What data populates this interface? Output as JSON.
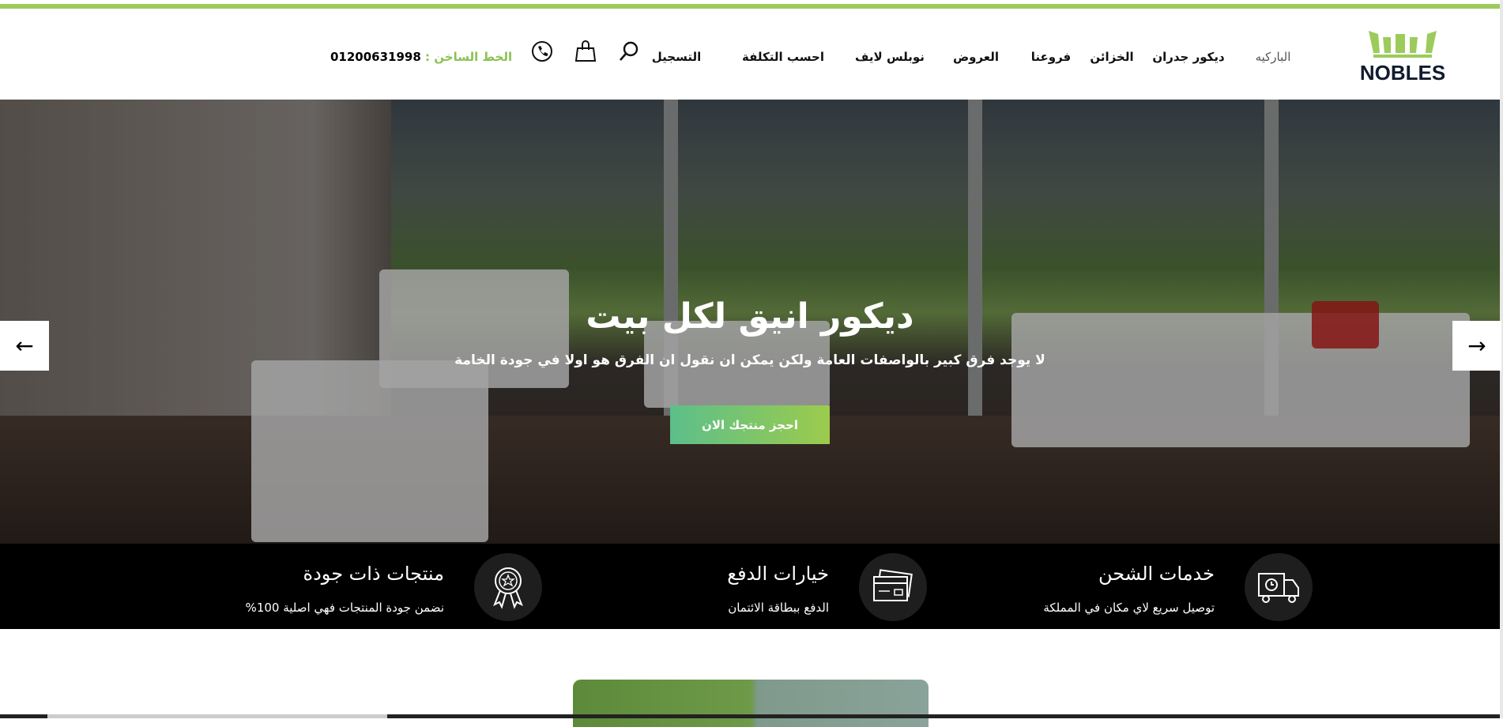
{
  "brand": {
    "name": "NOBLES",
    "accent": "#9ccb5c"
  },
  "nav": {
    "items": [
      {
        "label": "الباركيه",
        "active": true
      },
      {
        "label": "ديكور جدران"
      },
      {
        "label": "الخزائن"
      },
      {
        "label": "فروعنا"
      },
      {
        "label": "العروض"
      },
      {
        "label": "نوبلس لايف"
      },
      {
        "label": "احسب التكلفة"
      },
      {
        "label": "التسجيل"
      }
    ],
    "icons": [
      "search-icon",
      "shopping-bag-icon",
      "phone-icon"
    ],
    "hotline_label": "الخط الساخن : ",
    "hotline_number": "01200631998"
  },
  "hero": {
    "title": "ديكور انيق لكل بيت",
    "subtitle": "لا يوجد فرق كبير بالواصفات العامة ولكن يمكن ان نقول ان الفرق هو اولا في جودة الخامة",
    "button": "احجز منتجك الان",
    "prev": "🡐",
    "next": "🡒"
  },
  "features": [
    {
      "icon": "delivery-truck-icon",
      "title": "خدمات الشحن",
      "text": "توصيل سريع لاي مكان في المملكة"
    },
    {
      "icon": "credit-card-icon",
      "title": "خيارات الدفع",
      "text": "الدفع ببطاقة الائتمان"
    },
    {
      "icon": "award-badge-icon",
      "title": "منتجات ذات جودة",
      "text": "نضمن جودة المنتجات فهي اصلية 100%"
    }
  ]
}
